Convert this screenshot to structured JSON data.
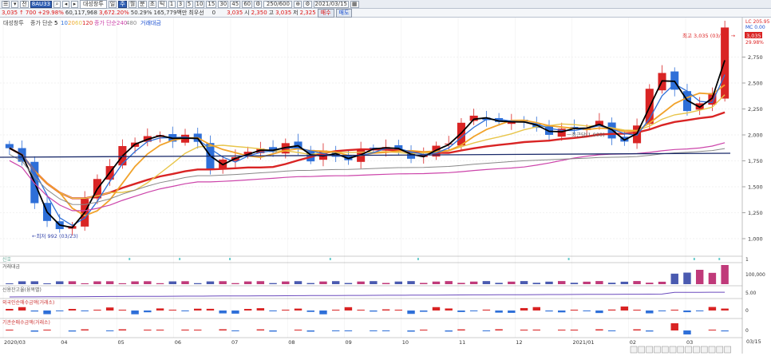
{
  "toolbar1": {
    "code_value": "8AU33",
    "stock_name": "대성창투",
    "period_buttons": [
      "일",
      "주",
      "월",
      "분",
      "초",
      "틱"
    ],
    "number_buttons": [
      "1",
      "3",
      "5",
      "10",
      "15",
      "30",
      "45",
      "60"
    ],
    "range_value": "250/600",
    "date_value": "2021/03/15"
  },
  "toolbar2": {
    "price": "3,035",
    "change": "700",
    "change_pct": "+29.98%",
    "volume": "60,117,968",
    "trade_value_pct": "3,672.20%",
    "ratio": "50.29%",
    "amount": "165,779백만",
    "dist_label": "최우선",
    "dist_value": "0",
    "price2": "3,035",
    "open_label": "시",
    "open": "2,350",
    "high_label": "고",
    "high": "3,035",
    "low_label": "저",
    "low": "2,325",
    "buy_label": "매수",
    "sell_label": "매도"
  },
  "legend": {
    "ma_label": "대성창투",
    "price_ma_label": "종가 단순",
    "price_ma_periods": [
      "5",
      "10",
      "20",
      "60",
      "120"
    ],
    "price_ma_colors": [
      "#000000",
      "#2e6fd8",
      "#f1a22a",
      "#e8c54a",
      "#d92424"
    ],
    "long_ma_label": "종가 단순",
    "long_ma_periods": [
      "240",
      "480"
    ],
    "long_ma_colors": [
      "#cc44aa",
      "#888888"
    ],
    "volume_ma_label": "거래대금"
  },
  "right_top": {
    "label1": "LC 205.95",
    "label2": "MC 0.00",
    "last_price": "3,035",
    "last_pct": "29.98%"
  },
  "annotations": {
    "high": "최고 3,035 (03/15) →",
    "low": "←최저 992 (03/23)",
    "mid": "ㅡ최근당(1,000)"
  },
  "price_axis": [
    "2,750",
    "2,500",
    "2,250",
    "2,000",
    "1,750",
    "1,500",
    "1,250",
    "1,000"
  ],
  "panels": {
    "signal_label": "신호",
    "signal_tick": "1",
    "volume_label": "거래대금",
    "volume_tick": "100,000",
    "credit_label": "신용잔고율(융목별)",
    "credit_tick": "5.00",
    "foreign_label": "외국인순매수금액(거래소)",
    "foreign_tick": "0",
    "inst_label": "기관순매수금액(거래소)",
    "inst_tick": "0"
  },
  "x_axis": [
    "2020/03",
    "04",
    "05",
    "06",
    "07",
    "08",
    "09",
    "10",
    "11",
    "12",
    "2021/01",
    "02",
    "03"
  ],
  "x_axis_right": "03/15",
  "colors": {
    "up": "#d92424",
    "down": "#2e6fd8",
    "bg": "#ffffff",
    "grid": "#e4e4e4"
  },
  "chart_data": {
    "type": "candlestick",
    "y_range": [
      900,
      3100
    ],
    "price_range_visible": [
      992,
      3035
    ],
    "last_close": 3035,
    "period_high": 3035,
    "period_low": 992,
    "x_start": "2020/03",
    "x_end": "2021/03/15",
    "close_series_approx": [
      1850,
      1700,
      1300,
      1050,
      1080,
      1300,
      1550,
      1700,
      1900,
      1980,
      1950,
      2000,
      1980,
      1950,
      1700,
      1750,
      1800,
      1850,
      1860,
      1900,
      1860,
      1800,
      1820,
      1760,
      1800,
      1880,
      1880,
      1850,
      1820,
      1770,
      1900,
      2000,
      2150,
      2200,
      2100,
      2150,
      2100,
      2050,
      2050,
      2000,
      2100,
      2150,
      1960,
      1950,
      2100,
      2600,
      2550,
      2300,
      2250,
      2300,
      3035
    ]
  }
}
